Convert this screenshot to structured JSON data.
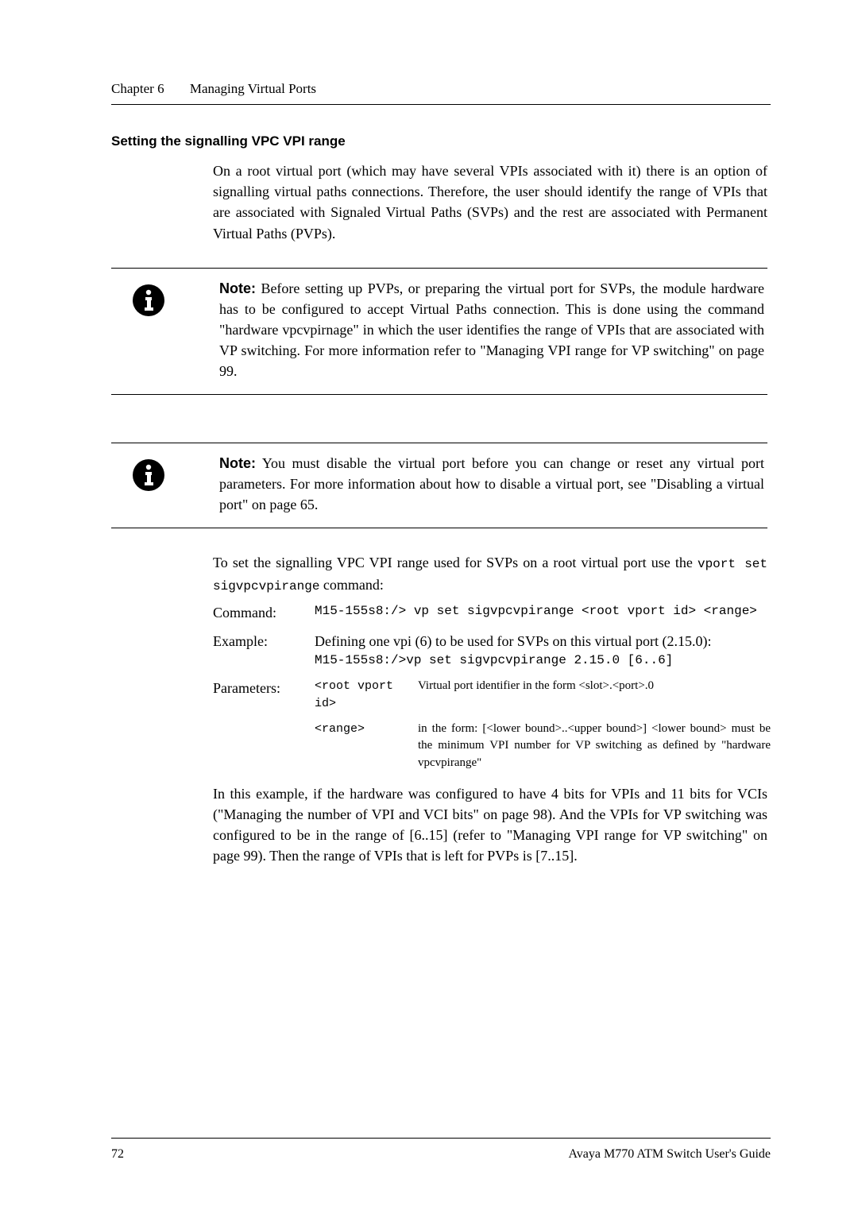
{
  "header": {
    "chapter_label": "Chapter 6",
    "chapter_title": "Managing Virtual Ports"
  },
  "heading1": "Setting the signalling VPC VPI range",
  "para1": "On a root virtual port (which may have several VPIs associated with it) there is an option of signalling virtual paths connections. Therefore, the user should identify the range of VPIs that are associated with Signaled Virtual Paths (SVPs) and the rest are associated with Permanent Virtual Paths (PVPs).",
  "note1": {
    "label": "Note:",
    "text": "Before setting up PVPs, or preparing the virtual port for SVPs, the module hardware has to be configured to accept Virtual Paths connection. This is done using the command \"hardware vpcvpirnage\" in which the user identifies the range of VPIs that are associated with VP switching. For more information refer to \"Managing VPI range for VP switching\" on page 99."
  },
  "note2": {
    "label": "Note:",
    "text": "You must disable the virtual port before you can change or reset any virtual port parameters. For more information about how to disable a virtual port, see \"Disabling a virtual port\" on page 65."
  },
  "para2_lead": "To set the signalling VPC VPI range used for SVPs on a root virtual port use the ",
  "para2_cmd": "vport set sigvpcvpirange",
  "para2_tail": " command:",
  "command": {
    "label": "Command:",
    "text": "M15-155s8:/> vp set sigvpcvpirange <root vport id> <range>"
  },
  "example": {
    "label": "Example:",
    "intro": "Defining one vpi (6) to be used for SVPs on this virtual port (2.15.0):",
    "cmd": "M15-155s8:/>vp set sigvpcvpirange 2.15.0   [6..6]"
  },
  "params": {
    "label": "Parameters:",
    "p1_name": "<root vport id>",
    "p1_desc": "Virtual port identifier in the form <slot>.<port>.0",
    "p2_name": "<range>",
    "p2_desc": "in the form: [<lower bound>..<upper bound>] <lower bound> must be the minimum VPI number for VP switching as defined by \"hardware vpcvpirange\""
  },
  "para3": "In this example, if the hardware was configured to have 4 bits for VPIs and 11 bits for VCIs (\"Managing the number of VPI and VCI bits\" on page 98). And the VPIs for VP switching was configured to be in the range of [6..15] (refer to \"Managing VPI range for VP switching\" on page 99). Then the range of VPIs that is left for PVPs is [7..15].",
  "footer": {
    "page": "72",
    "right": "Avaya M770 ATM Switch User's Guide"
  }
}
